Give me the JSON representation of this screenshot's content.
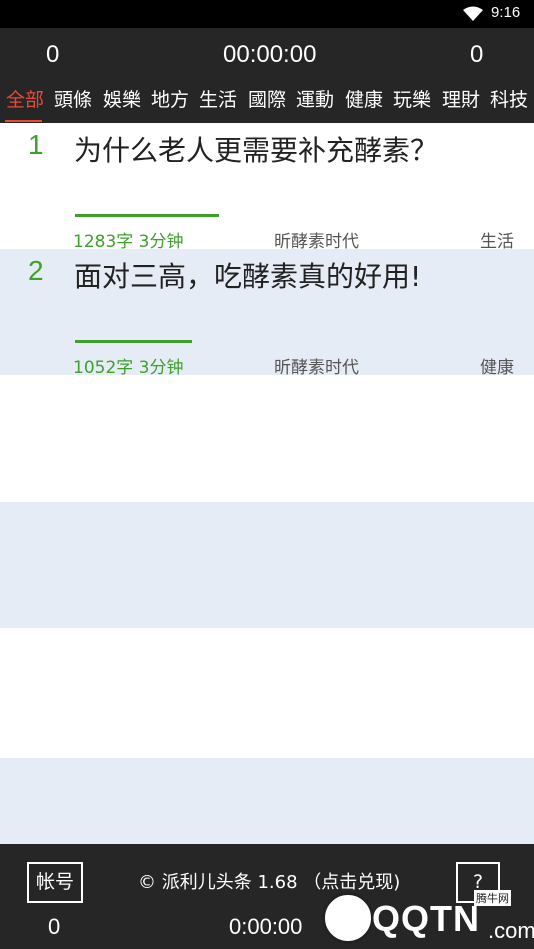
{
  "status_bar": {
    "time": "9:16",
    "wifi_icon": "wifi-icon"
  },
  "header": {
    "left_count": "0",
    "timer": "00:00:00",
    "right_count": "0"
  },
  "tabs": [
    {
      "label": "全部",
      "active": true
    },
    {
      "label": "頭條"
    },
    {
      "label": "娛樂"
    },
    {
      "label": "地方"
    },
    {
      "label": "生活"
    },
    {
      "label": "國際"
    },
    {
      "label": "運動"
    },
    {
      "label": "健康"
    },
    {
      "label": "玩樂"
    },
    {
      "label": "理財"
    },
    {
      "label": "科技"
    }
  ],
  "articles": [
    {
      "index": "1",
      "title": "为什么老人更需要补充酵素？",
      "meta": "1283字 3分钟",
      "source": "昕酵素时代",
      "category": "生活",
      "progress": 0.27
    },
    {
      "index": "2",
      "title": "面对三高，吃酵素真的好用!",
      "meta": "1052字 3分钟",
      "source": "昕酵素时代",
      "category": "健康",
      "progress": 0.22
    }
  ],
  "footer": {
    "account_label": "帐号",
    "copyright": "© 派利儿头条 1.68 （点击兑现)",
    "help_label": "?",
    "left_count": "0",
    "timer": "0:00:00"
  },
  "watermark": {
    "text": "QQTN",
    "suffix": ".com",
    "badge": "腾牛网"
  },
  "colors": {
    "accent": "#e84a3a",
    "green": "#3fa02b",
    "bar_bg": "#262626",
    "alt_row": "#e6ecf5"
  }
}
